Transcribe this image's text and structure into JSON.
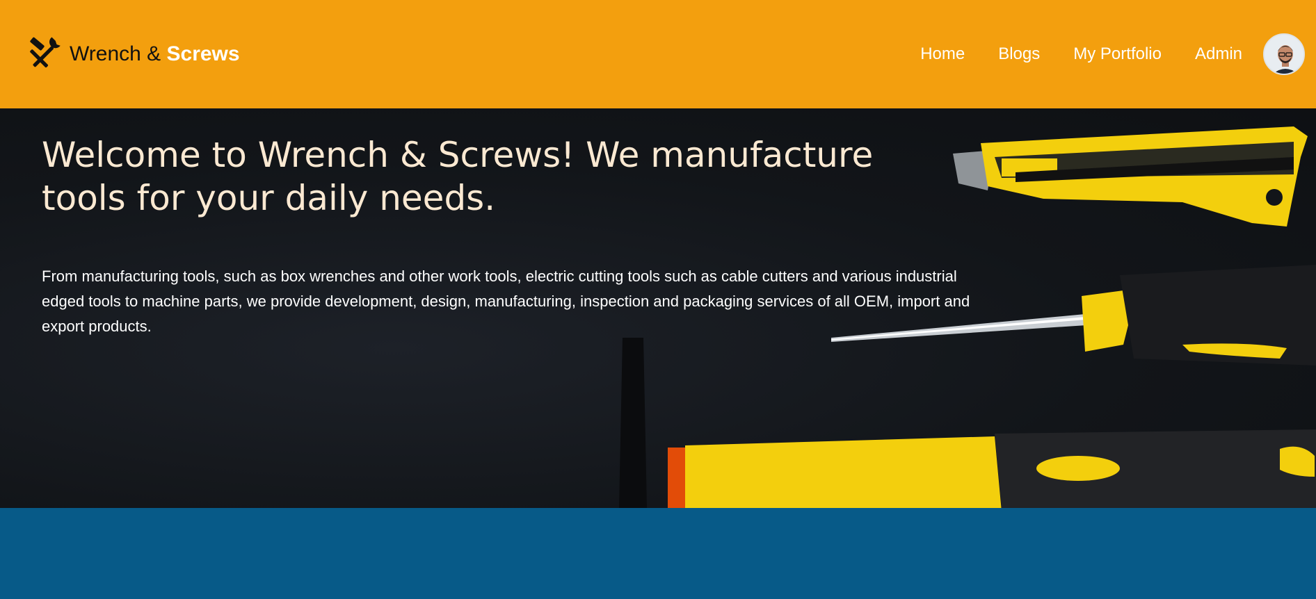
{
  "brand": {
    "name_part1": "Wrench & ",
    "name_part2": "Screws",
    "icon": "hammer-wrench-icon"
  },
  "nav": {
    "items": [
      {
        "label": "Home"
      },
      {
        "label": "Blogs"
      },
      {
        "label": "My Portfolio"
      },
      {
        "label": "Admin"
      }
    ],
    "avatar": "user-avatar"
  },
  "hero": {
    "title": "Welcome to Wrench & Screws! We manufacture tools for your daily needs.",
    "description": "From manufacturing tools, such as box wrenches and other work tools, electric cutting tools such as cable cutters and various industrial edged tools to machine parts, we provide development, design, manufacturing, inspection and packaging services of all OEM, import and export products.",
    "image": "tools-on-black-background"
  },
  "colors": {
    "navbar": "#f39f0e",
    "hero_bg": "#121519",
    "hero_title": "#fbe9d2",
    "bottom_band": "#075a88",
    "tool_yellow": "#f5d40f"
  }
}
